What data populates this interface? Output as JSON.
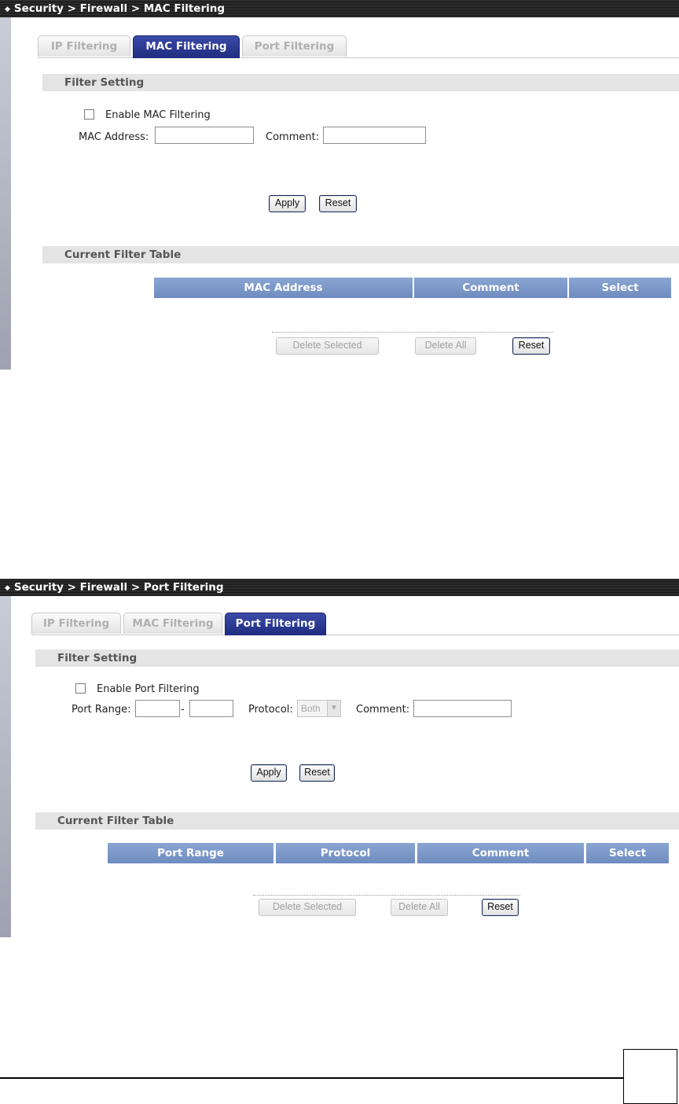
{
  "panels": [
    {
      "title": "Security > Firewall > MAC Filtering",
      "tabs": [
        "IP Filtering",
        "MAC Filtering",
        "Port Filtering"
      ],
      "active_tab": "MAC Filtering",
      "filter_setting": {
        "heading": "Filter Setting",
        "enable_label": "Enable MAC Filtering",
        "mac_address_label": "MAC Address:",
        "comment_label": "Comment:",
        "apply_label": "Apply",
        "reset_label": "Reset"
      },
      "current_table": {
        "heading": "Current Filter Table",
        "columns": [
          "MAC Address",
          "Comment",
          "Select"
        ],
        "delete_selected_label": "Delete Selected",
        "delete_all_label": "Delete All",
        "reset_label": "Reset"
      }
    },
    {
      "title": "Security > Firewall > Port Filtering",
      "tabs": [
        "IP Filtering",
        "MAC Filtering",
        "Port Filtering"
      ],
      "active_tab": "Port Filtering",
      "filter_setting": {
        "heading": "Filter Setting",
        "enable_label": "Enable Port Filtering",
        "port_range_label": "Port Range:",
        "range_separator": "-",
        "protocol_label": "Protocol:",
        "protocol_value": "Both",
        "comment_label": "Comment:",
        "apply_label": "Apply",
        "reset_label": "Reset"
      },
      "current_table": {
        "heading": "Current Filter Table",
        "columns": [
          "Port Range",
          "Protocol",
          "Comment",
          "Select"
        ],
        "delete_selected_label": "Delete Selected",
        "delete_all_label": "Delete All",
        "reset_label": "Reset"
      }
    }
  ],
  "icons": {
    "title_bullet": "diamond-icon",
    "dropdown_arrow": "chevron-down-icon"
  },
  "colors": {
    "active_tab": "#1f2c80",
    "table_header": "#7b97c9",
    "section_header_bg": "#e4e4e4"
  }
}
